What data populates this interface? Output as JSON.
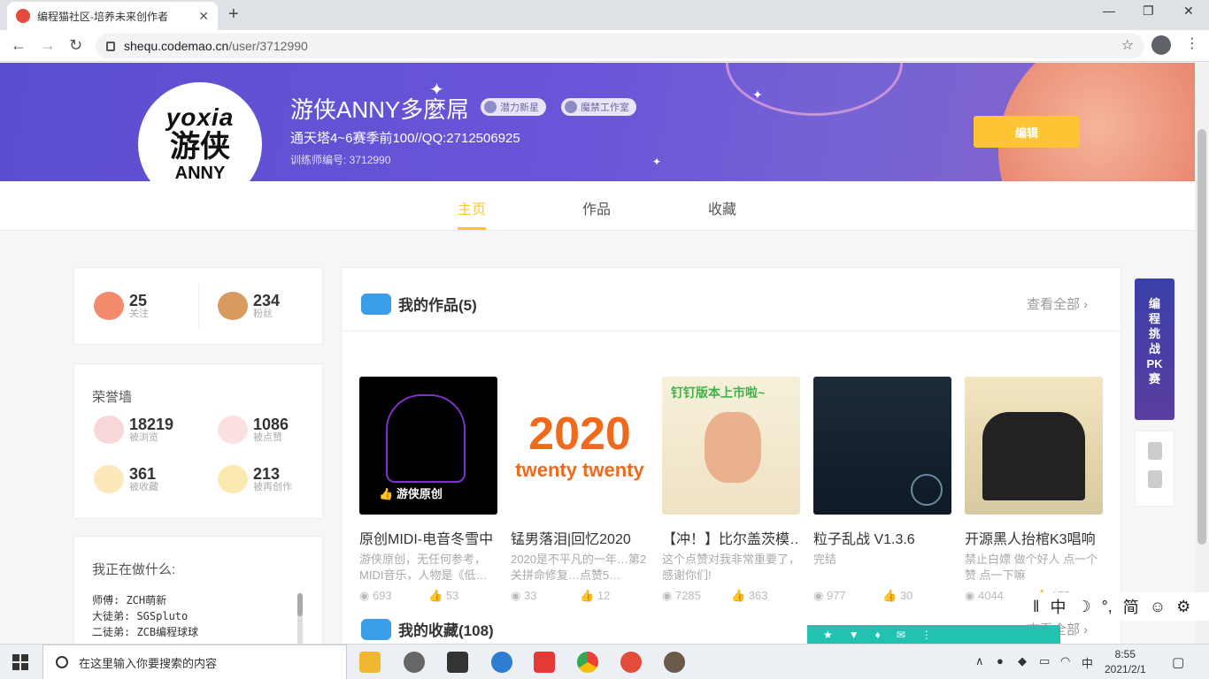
{
  "browser": {
    "tab_title": "编程猫社区-培养未来创作者",
    "tab_close": "✕",
    "new_tab": "+",
    "url_host": "shequ.codemao.cn",
    "url_path": "/user/3712990",
    "min": "—",
    "max": "❐",
    "close": "✕"
  },
  "profile": {
    "avatar_line1": "yoxia",
    "avatar_line2": "游侠",
    "avatar_line3": "ANNY",
    "name": "游侠ANNY多麼屌",
    "badges": [
      "潜力新星",
      "魔禁工作室"
    ],
    "bio": "通天塔4~6赛季前100//QQ:2712506925",
    "trainer_id": "训练师编号: 3712990",
    "edit_label": "编辑"
  },
  "nav": {
    "tabs": [
      "主页",
      "作品",
      "收藏"
    ]
  },
  "follow": {
    "following": {
      "num": "25",
      "label": "关注"
    },
    "fans": {
      "num": "234",
      "label": "粉丝"
    }
  },
  "honor": {
    "title": "荣誉墙",
    "views": {
      "num": "18219",
      "label": "被浏览"
    },
    "likes": {
      "num": "1086",
      "label": "被点赞"
    },
    "collects": {
      "num": "361",
      "label": "被收藏"
    },
    "remix": {
      "num": "213",
      "label": "被再创作"
    }
  },
  "doing": {
    "title": "我正在做什么:",
    "lines": [
      "师傅: ZCH萌新",
      "大徒弟: SGSpluto",
      "二徒弟: ZCB编程球球"
    ]
  },
  "works": {
    "title": "我的作品(5)",
    "view_all": "查看全部 ›",
    "items": [
      {
        "title": "原创MIDI-电音冬雪中",
        "desc": "游侠原创，无任何参考，MIDI音乐，人物是《低…",
        "views": "693",
        "likes": "53",
        "thumb_text": "游侠原创"
      },
      {
        "title": "锰男落泪|回忆2020",
        "desc": "2020是不平凡的一年…第2关拼命修复…点赞5…",
        "views": "33",
        "likes": "12",
        "thumb_text": "2020"
      },
      {
        "title": "【冲！】比尔盖茨模…",
        "desc": "这个点赞对我非常重要了，感谢你们!",
        "views": "7285",
        "likes": "363",
        "thumb_text": "钉钉版本上市啦~"
      },
      {
        "title": "粒子乱战 V1.3.6",
        "desc": "完结",
        "views": "977",
        "likes": "30",
        "thumb_text": ""
      },
      {
        "title": "开源黑人抬棺K3唱响",
        "desc": "禁止白嫖 做个好人 点一个赞 点一下嘛",
        "views": "4044",
        "likes": "175",
        "thumb_text": ""
      }
    ]
  },
  "collections": {
    "title": "我的收藏(108)",
    "view_all": "查看全部 ›"
  },
  "ad": {
    "lines": [
      "编",
      "程",
      "挑",
      "战",
      "PK",
      "赛"
    ]
  },
  "ime": [
    "‖",
    "中",
    "☽",
    "°,",
    "简",
    "☺",
    "⚙"
  ],
  "taskbar": {
    "search_placeholder": "在这里输入你要搜索的内容",
    "time": "8:55",
    "date": "2021/2/1",
    "ime_lang": "中"
  },
  "colors": {
    "accent": "#fec433",
    "banner": "#6b55d8"
  }
}
